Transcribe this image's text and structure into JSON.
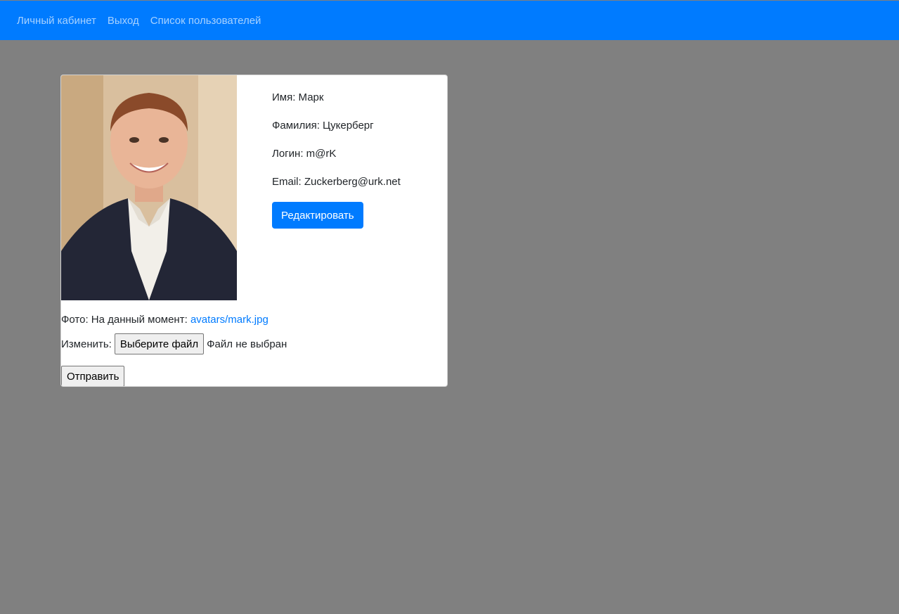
{
  "nav": {
    "items": [
      {
        "label": "Личный кабинет"
      },
      {
        "label": "Выход"
      },
      {
        "label": "Список пользователей"
      }
    ]
  },
  "profile": {
    "first_name": "Имя: Марк",
    "last_name": "Фамилия: Цукерберг",
    "login": "Логин: m@rK",
    "email": "Email: Zuckerberg@urk.net",
    "edit_label": "Редактировать"
  },
  "photo": {
    "prefix": "Фото: На данный момент: ",
    "current_link": "avatars/mark.jpg"
  },
  "upload": {
    "change_label": "Изменить:",
    "choose_file_label": "Выберите файл",
    "no_file_text": "Файл не выбран",
    "submit_label": "Отправить"
  },
  "colors": {
    "navbar": "#007bff",
    "background": "#808080",
    "primary_button": "#007bff",
    "link": "#007bff"
  }
}
